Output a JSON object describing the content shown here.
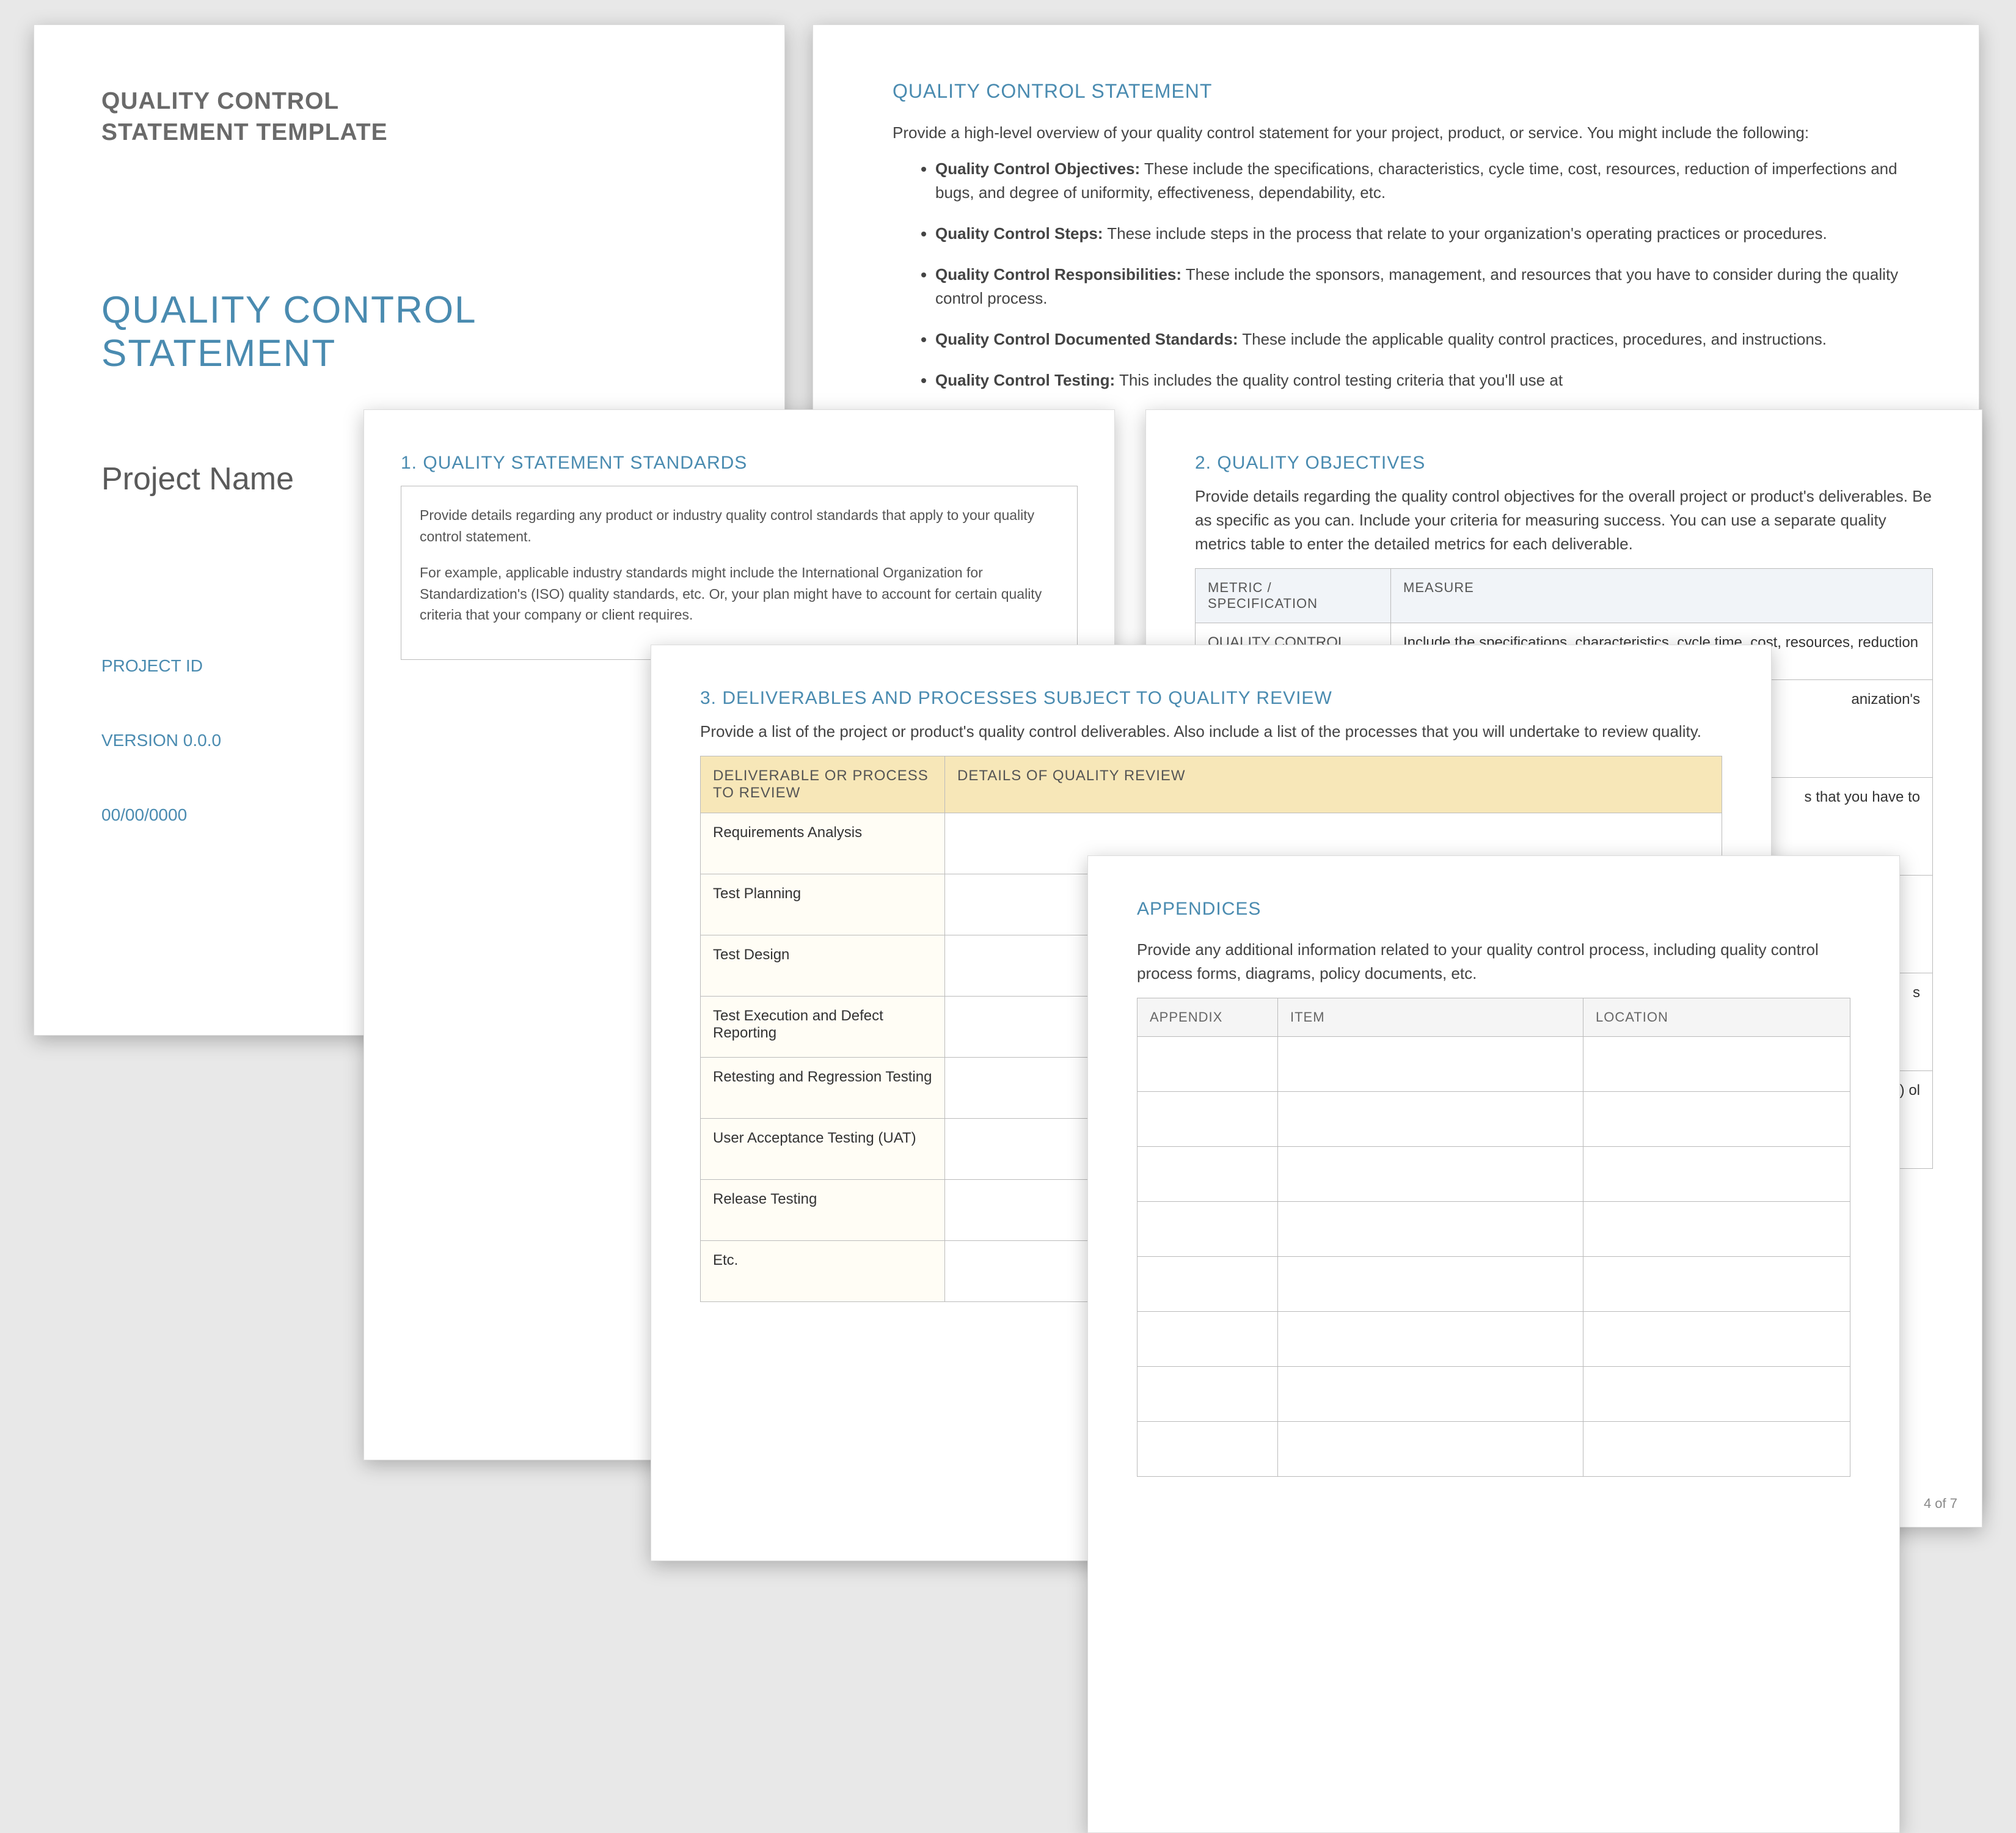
{
  "cover": {
    "template_title_l1": "QUALITY CONTROL",
    "template_title_l2": "STATEMENT TEMPLATE",
    "doc_title": "QUALITY CONTROL STATEMENT",
    "project_name": "Project Name",
    "project_id": "PROJECT ID",
    "version": "VERSION 0.0.0",
    "date": "00/00/0000"
  },
  "qc_statement": {
    "heading": "QUALITY CONTROL STATEMENT",
    "intro": "Provide a high-level overview of your quality control statement for your project, product, or service. You might include the following:",
    "items": [
      {
        "label": "Quality Control Objectives:",
        "text": " These include the specifications, characteristics, cycle time, cost, resources, reduction of imperfections and bugs, and degree of uniformity, effectiveness, dependability, etc."
      },
      {
        "label": "Quality Control Steps:",
        "text": " These include steps in the process that relate to your organization's operating practices or procedures."
      },
      {
        "label": "Quality Control Responsibilities:",
        "text": " These include the sponsors, management, and resources that you have to consider during the quality control process."
      },
      {
        "label": "Quality Control Documented Standards:",
        "text": " These include the applicable quality control practices, procedures, and instructions."
      },
      {
        "label": "Quality Control Testing:",
        "text": " This includes the quality control testing criteria that you'll use at"
      }
    ]
  },
  "standards": {
    "heading": "1.   QUALITY STATEMENT STANDARDS",
    "p1": "Provide details regarding any product or industry quality control standards that apply to your quality control statement.",
    "p2": "For example, applicable industry standards might include the International Organization for Standardization's (ISO) quality standards, etc. Or, your plan might have to account for certain quality criteria that your company or client requires."
  },
  "objectives": {
    "heading": "2.   QUALITY OBJECTIVES",
    "intro": "Provide details regarding the quality control objectives for the overall project or product's deliverables. Be as specific as you can. Include your criteria for measuring success. You can use a separate quality metrics table to enter the detailed metrics for each deliverable.",
    "th1": "METRIC / SPECIFICATION",
    "th2": "MEASURE",
    "rows": [
      {
        "metric": "QUALITY CONTROL OBJECTIVES",
        "measure": "Include the specifications, characteristics, cycle time, cost, resources, reduction of imperfections and bugs, and degree of"
      },
      {
        "metric": "",
        "measure": "anization's"
      },
      {
        "metric": "",
        "measure": "s that you have to"
      },
      {
        "metric": "",
        "measure": ""
      },
      {
        "metric": "",
        "measure": "s"
      },
      {
        "metric": "",
        "measure": "P(s) ol"
      }
    ],
    "page_num": "4 of 7"
  },
  "deliverables": {
    "heading": "3.   DELIVERABLES AND PROCESSES SUBJECT TO QUALITY REVIEW",
    "intro": "Provide a list of the project or product's quality control deliverables. Also include a list of the processes that you will undertake to review quality.",
    "th1": "DELIVERABLE OR PROCESS TO REVIEW",
    "th2": "DETAILS OF QUALITY REVIEW",
    "rows": [
      "Requirements Analysis",
      "Test Planning",
      "Test Design",
      "Test Execution and Defect Reporting",
      "Retesting and Regression Testing",
      "User Acceptance Testing (UAT)",
      "Release Testing",
      "Etc."
    ]
  },
  "appendices": {
    "heading": "APPENDICES",
    "intro": "Provide any additional information related to your quality control process, including quality control process forms, diagrams, policy documents, etc.",
    "th1": "APPENDIX",
    "th2": "ITEM",
    "th3": "LOCATION",
    "blank_rows": 8
  }
}
